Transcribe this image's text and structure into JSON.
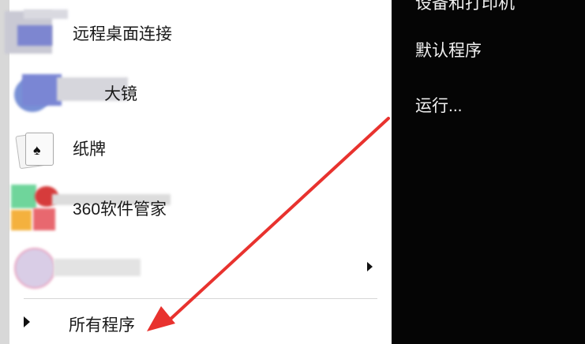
{
  "start_menu": {
    "programs": [
      {
        "label": "远程桌面连接",
        "icon": "remote-desktop-icon",
        "submenu": false
      },
      {
        "label": "大镜",
        "icon": "magnifier-icon",
        "submenu": false
      },
      {
        "label": "纸牌",
        "icon": "solitaire-icon",
        "submenu": false
      },
      {
        "label": "360软件管家",
        "icon": "360-software-manager-icon",
        "submenu": false
      },
      {
        "label": "",
        "icon": "blurred-app-icon",
        "submenu": true
      }
    ],
    "all_programs_label": "所有程序",
    "right_items": [
      {
        "label": "设备和打印机"
      },
      {
        "label": "默认程序"
      },
      {
        "label": "运行..."
      }
    ]
  },
  "colors": {
    "left_pane": "#ffffff",
    "right_pane": "#050505",
    "annotation_arrow": "#e8322e"
  }
}
